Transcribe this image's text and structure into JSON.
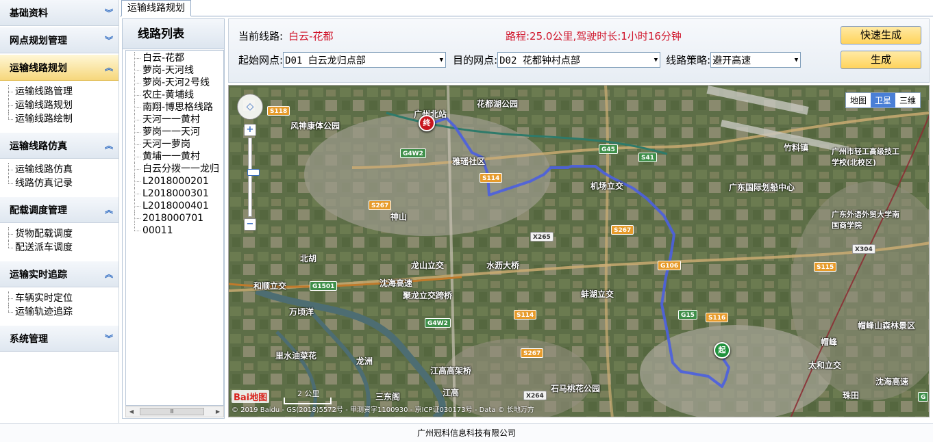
{
  "sidebar": {
    "groups": [
      {
        "title": "基础资料",
        "chevron": "︾",
        "items": []
      },
      {
        "title": "网点规划管理",
        "chevron": "︾",
        "items": []
      },
      {
        "title": "运输线路规划",
        "chevron": "︽",
        "items": [
          "运输线路管理",
          "运输线路规划",
          "运输线路绘制"
        ]
      },
      {
        "title": "运输线路仿真",
        "chevron": "︽",
        "items": [
          "运输线路仿真",
          "线路仿真记录"
        ]
      },
      {
        "title": "配载调度管理",
        "chevron": "︽",
        "items": [
          "货物配载调度",
          "配送派车调度"
        ]
      },
      {
        "title": "运输实时追踪",
        "chevron": "︽",
        "items": [
          "车辆实时定位",
          "运输轨迹追踪"
        ]
      },
      {
        "title": "系统管理",
        "chevron": "︾",
        "items": []
      }
    ]
  },
  "tab": {
    "label": "运输线路规划"
  },
  "route_panel": {
    "title": "线路列表",
    "routes": [
      "白云-花都",
      "萝岗-天河线",
      "萝岗-天河2号线",
      "农庄-黄埔线",
      "南翔-博思格线路",
      "天河一一黄村",
      "萝岗一一天河",
      "天河一萝岗",
      "黄埔一一黄村",
      "白云分拨一一龙归",
      "L2018000201",
      "L2018000301",
      "L2018000401",
      "2018000701",
      "00011"
    ],
    "scroll_thumb": "Ⅲ"
  },
  "form": {
    "current_route_label": "当前线路:",
    "current_route_value": "白云-花都",
    "distance_text": "路程:25.0公里,驾驶时长:1小时16分钟",
    "start_label": "起始网点:",
    "start_value": "D01 白云龙归点部",
    "dest_label": "目的网点:",
    "dest_value": "D02 花都钟村点部",
    "strategy_label": "线路策略:",
    "strategy_value": "避开高速",
    "quick_button": "快速生成",
    "generate_button": "生成"
  },
  "map": {
    "type_buttons": [
      "地图",
      "卫星",
      "三维"
    ],
    "active_type": "卫星",
    "zoom_level_fraction": 0.42,
    "labels": [
      "风神康体公园",
      "广州北站",
      "花都湖公园",
      "雅瑶社区",
      "机场立交",
      "竹料镇",
      "广州市轻工高级技工学校(北校区)",
      "广东国际划船中心",
      "广东外语外贸大学南国商学院",
      "神山",
      "龙山立交",
      "水沥大桥",
      "和顺立交",
      "沈海高速",
      "聚龙立交跨桥",
      "蚌湖立交",
      "万顷洋",
      "里水油菜花",
      "江高高架桥",
      "石马桃花公园",
      "太和立交",
      "帽峰山森林景区",
      "北胡",
      "龙洲",
      "三东阁",
      "帽峰",
      "珠田",
      "江高",
      "沈海高速"
    ],
    "shields": [
      "S118",
      "G4W2",
      "G45",
      "S41",
      "S114",
      "S267",
      "X265",
      "S267",
      "G106",
      "G1501",
      "G4W2",
      "S114",
      "G15",
      "S116",
      "S267",
      "X264",
      "X304",
      "S115",
      "G"
    ],
    "start_marker": "起",
    "end_marker": "终",
    "logo": "Bai地图",
    "scale_label": "2 公里",
    "copyright": "© 2019 Baidu - GS(2018)5572号 - 甲测资字1100930 - 京ICP证030173号 - Data © 长地万方"
  },
  "footer": {
    "company": "广州冠科信息科技有限公司"
  },
  "colors": {
    "route": "#4b5fe0",
    "active_header": "#f6d77c",
    "accent_red": "#d0142a"
  }
}
